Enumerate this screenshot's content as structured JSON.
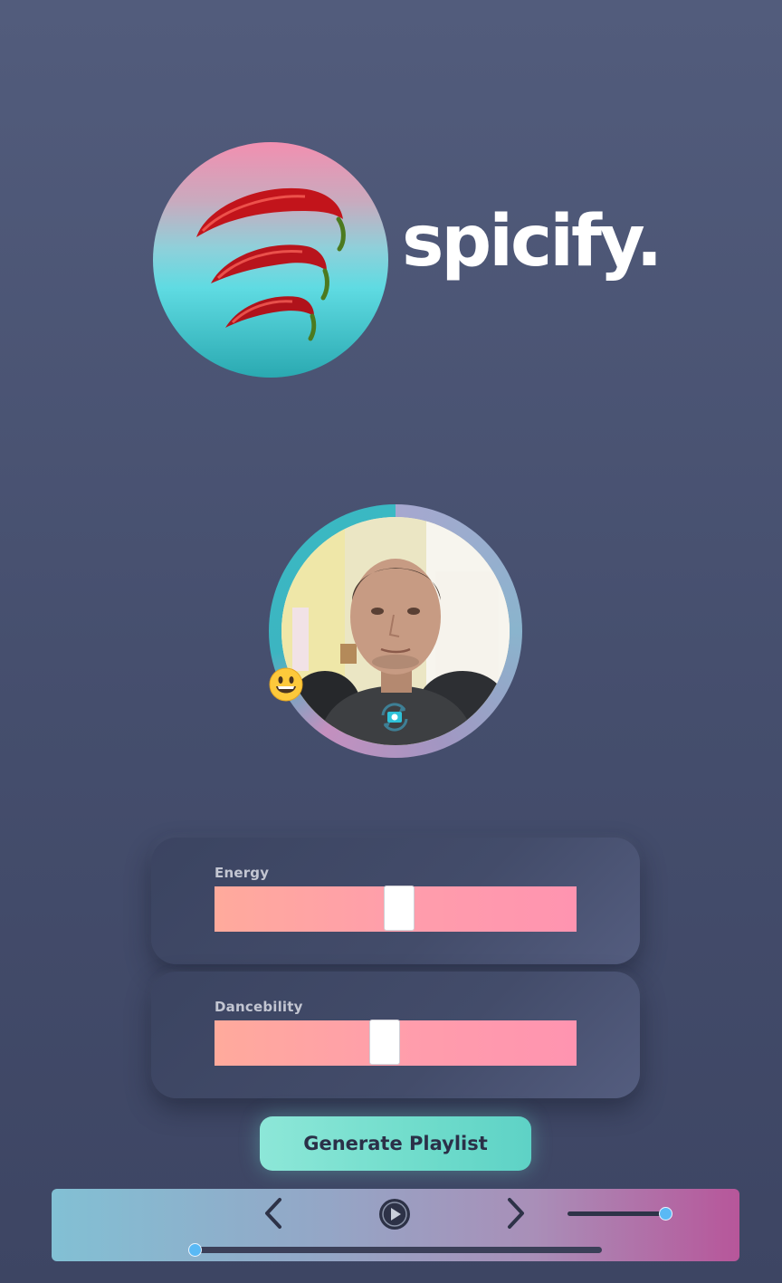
{
  "brand": {
    "name": "spicify.",
    "logo_icon": "chili-peppers-logo"
  },
  "camera": {
    "mood_emoji": "😀",
    "mood_icon": "grinning-face-icon",
    "switch_icon": "switch-camera-icon"
  },
  "sliders": [
    {
      "label": "Energy",
      "value": 0.51
    },
    {
      "label": "Dancebility",
      "value": 0.47
    }
  ],
  "generate_button": {
    "label": "Generate Playlist"
  },
  "player": {
    "prev_icon": "chevron-left-icon",
    "play_icon": "play-circle-icon",
    "next_icon": "chevron-right-icon",
    "volume": 1.0,
    "progress": 0.0
  },
  "colors": {
    "background": "#4b5474",
    "accent_teal": "#6fdccb",
    "slider_pink": "#ff9eab",
    "knob_blue": "#5ab9f5"
  }
}
